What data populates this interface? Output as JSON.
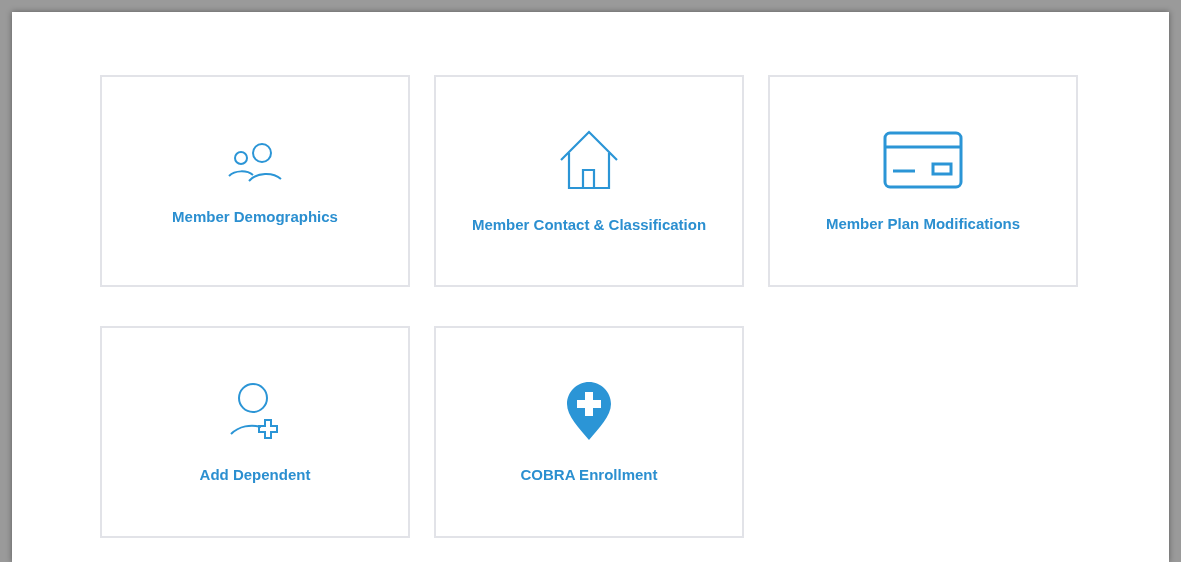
{
  "tiles": [
    {
      "label": "Member Demographics",
      "kind": "people"
    },
    {
      "label": "Member Contact & Classification",
      "kind": "house"
    },
    {
      "label": "Member Plan Modifications",
      "kind": "card"
    },
    {
      "label": "Add Dependent",
      "kind": "person-add"
    },
    {
      "label": "COBRA Enrollment",
      "kind": "pin-plus"
    }
  ]
}
